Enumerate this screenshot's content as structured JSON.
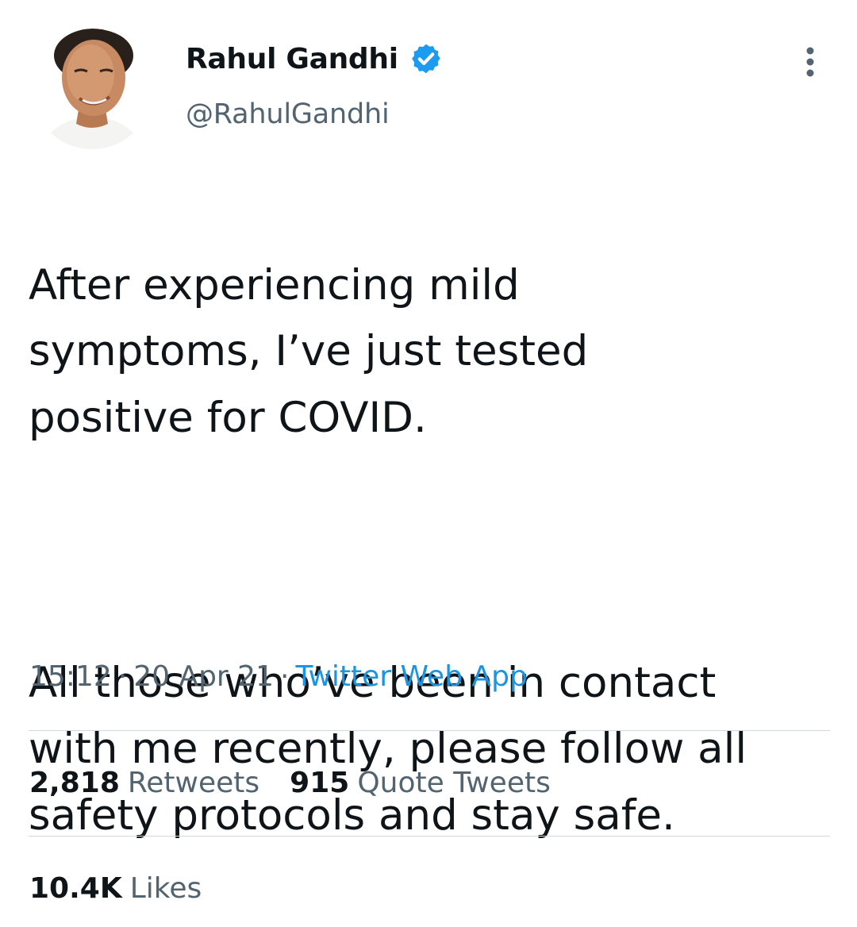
{
  "author": {
    "name": "Rahul Gandhi",
    "handle": "@RahulGandhi",
    "verified": true,
    "verified_color": "#1d9bf0",
    "avatar_icon": "profile-photo"
  },
  "tweet": {
    "paragraph_1": "After experiencing mild\nsymptoms, I’ve just tested\npositive for COVID.",
    "paragraph_2": "All those who’ve been in contact\nwith me recently, please follow all\nsafety protocols and stay safe."
  },
  "meta": {
    "time": "15:12",
    "date": "20 Apr 21",
    "separator": "·",
    "source": "Twitter Web App",
    "source_color": "#1b95e0"
  },
  "stats": {
    "retweets_count": "2,818",
    "retweets_label": "Retweets",
    "quotes_count": "915",
    "quotes_label": "Quote Tweets",
    "likes_count": "10.4K",
    "likes_label": "Likes"
  },
  "icons": {
    "more": "more-vertical-icon",
    "verified": "verified-badge-icon"
  }
}
